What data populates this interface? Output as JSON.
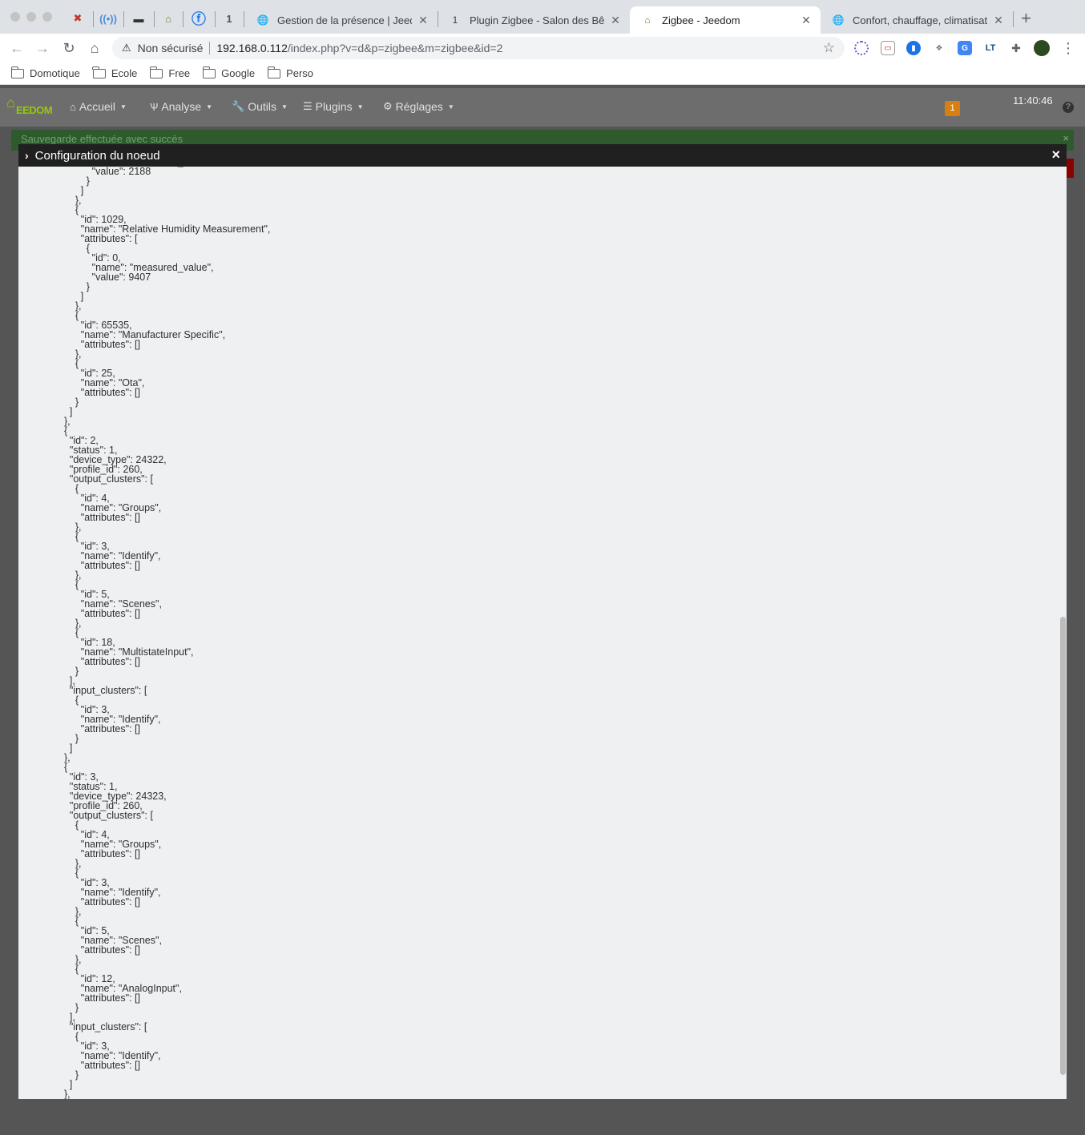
{
  "browser": {
    "tabs": [
      {
        "title": "Gestion de la présence | Jeedom",
        "active": false
      },
      {
        "title": "Plugin Zigbee - Salon des Bêta-testeurs",
        "active": false
      },
      {
        "title": "Zigbee - Jeedom",
        "active": true
      },
      {
        "title": "Confort, chauffage, climatisation",
        "active": false
      }
    ],
    "address": {
      "security": "Non sécurisé",
      "host": "192.168.0.112",
      "path": "/index.php?v=d&p=zigbee&m=zigbee&id=2"
    },
    "bookmarks": [
      "Domotique",
      "Ecole",
      "Free",
      "Google",
      "Perso"
    ]
  },
  "jeedom": {
    "logo_text": "EEDOM",
    "menu": [
      "Accueil",
      "Analyse",
      "Outils",
      "Plugins",
      "Réglages"
    ],
    "badge": "1",
    "clock": "11:40:46",
    "help": "?"
  },
  "alert": {
    "text": "Sauvegarde effectuée avec succès",
    "close": "×"
  },
  "modal": {
    "title": "Configuration du noeud",
    "close": "×",
    "json_text": "            \"name\": \"measured_value\",\n            \"value\": 2188\n          }\n        ]\n      },\n      {\n        \"id\": 1029,\n        \"name\": \"Relative Humidity Measurement\",\n        \"attributes\": [\n          {\n            \"id\": 0,\n            \"name\": \"measured_value\",\n            \"value\": 9407\n          }\n        ]\n      },\n      {\n        \"id\": 65535,\n        \"name\": \"Manufacturer Specific\",\n        \"attributes\": []\n      },\n      {\n        \"id\": 25,\n        \"name\": \"Ota\",\n        \"attributes\": []\n      }\n    ]\n  },\n  {\n    \"id\": 2,\n    \"status\": 1,\n    \"device_type\": 24322,\n    \"profile_id\": 260,\n    \"output_clusters\": [\n      {\n        \"id\": 4,\n        \"name\": \"Groups\",\n        \"attributes\": []\n      },\n      {\n        \"id\": 3,\n        \"name\": \"Identify\",\n        \"attributes\": []\n      },\n      {\n        \"id\": 5,\n        \"name\": \"Scenes\",\n        \"attributes\": []\n      },\n      {\n        \"id\": 18,\n        \"name\": \"MultistateInput\",\n        \"attributes\": []\n      }\n    ],\n    \"input_clusters\": [\n      {\n        \"id\": 3,\n        \"name\": \"Identify\",\n        \"attributes\": []\n      }\n    ]\n  },\n  {\n    \"id\": 3,\n    \"status\": 1,\n    \"device_type\": 24323,\n    \"profile_id\": 260,\n    \"output_clusters\": [\n      {\n        \"id\": 4,\n        \"name\": \"Groups\",\n        \"attributes\": []\n      },\n      {\n        \"id\": 3,\n        \"name\": \"Identify\",\n        \"attributes\": []\n      },\n      {\n        \"id\": 5,\n        \"name\": \"Scenes\",\n        \"attributes\": []\n      },\n      {\n        \"id\": 12,\n        \"name\": \"AnalogInput\",\n        \"attributes\": []\n      }\n    ],\n    \"input_clusters\": [\n      {\n        \"id\": 3,\n        \"name\": \"Identify\",\n        \"attributes\": []\n      }\n    ]\n  },"
  }
}
